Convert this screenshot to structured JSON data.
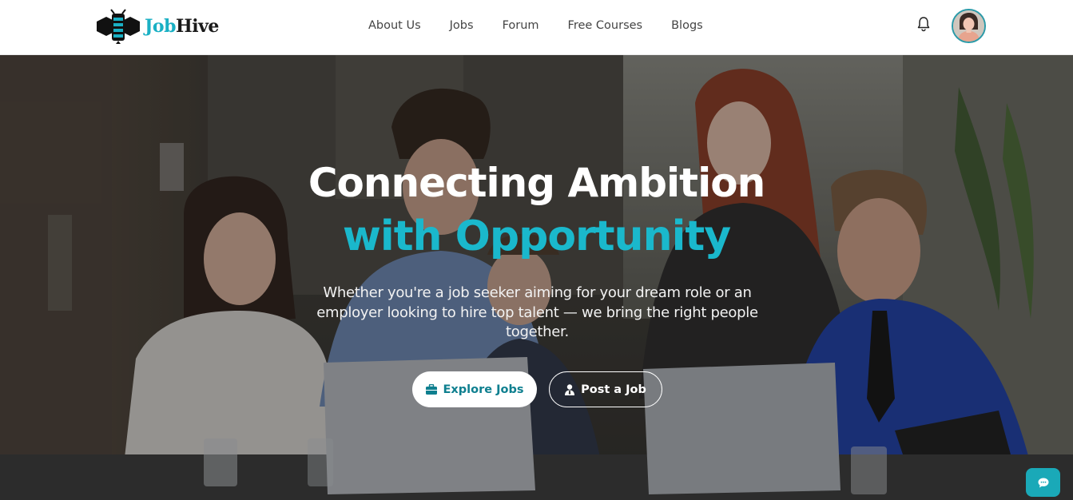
{
  "brand": {
    "name_part1": "Job",
    "name_part2": "Hive",
    "logo_icon": "bee-icon",
    "accent_color": "#1ab0c4"
  },
  "nav": {
    "links": [
      "About Us",
      "Jobs",
      "Forum",
      "Free Courses",
      "Blogs"
    ],
    "notification_icon": "bell-icon",
    "avatar_icon": "user-avatar"
  },
  "hero": {
    "title_line1": "Connecting Ambition",
    "title_line2": "with Opportunity",
    "subtitle": "Whether you're a job seeker aiming for your dream role or an employer looking to hire top talent — we bring the right people together.",
    "buttons": {
      "explore": {
        "label": "Explore Jobs",
        "icon": "briefcase-icon"
      },
      "post": {
        "label": "Post a Job",
        "icon": "user-tie-icon"
      }
    },
    "background": "office-team-photo"
  },
  "chat": {
    "icon": "chat-bubble-icon"
  }
}
